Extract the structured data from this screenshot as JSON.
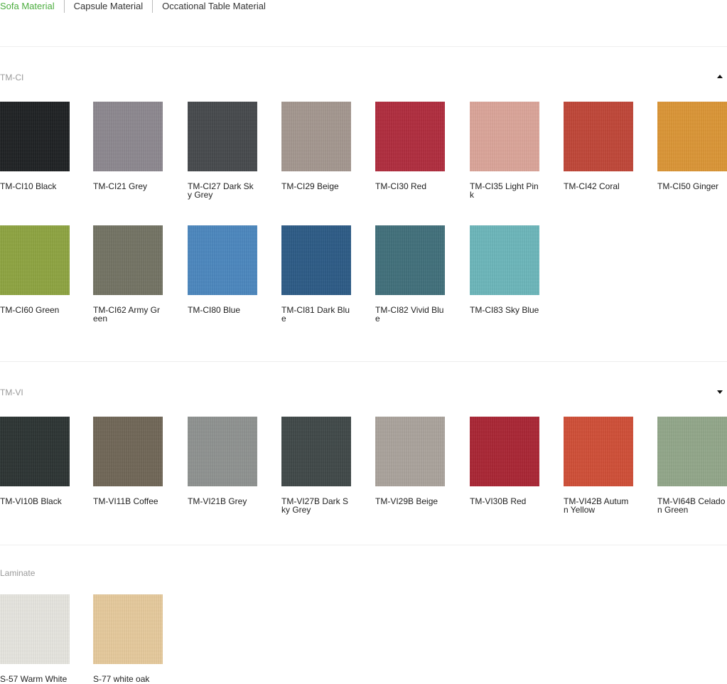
{
  "tabs": [
    {
      "label": "Sofa Material",
      "active": true
    },
    {
      "label": "Capsule Material",
      "active": false
    },
    {
      "label": "Occational Table Material",
      "active": false
    }
  ],
  "accent_color": "#4cad3f",
  "sections": [
    {
      "title": "TM-CI",
      "toggle": "collapse-up-icon",
      "swatches": [
        {
          "label": "TM-CI10 Black",
          "color": "#1c1f21"
        },
        {
          "label": "TM-CI21 Grey",
          "color": "#8d8890"
        },
        {
          "label": "TM-CI27 Dark Sky Grey",
          "color": "#45484b"
        },
        {
          "label": "TM-CI29 Beige",
          "color": "#a59890"
        },
        {
          "label": "TM-CI30 Red",
          "color": "#b22a3c"
        },
        {
          "label": "TM-CI35 Light Pink",
          "color": "#dea69a"
        },
        {
          "label": "TM-CI42 Coral",
          "color": "#c24536"
        },
        {
          "label": "TM-CI50 Ginger",
          "color": "#de9634"
        },
        {
          "label": "TM-CI60 Green",
          "color": "#8ea53f"
        },
        {
          "label": "TM-CI62 Army Green",
          "color": "#737363"
        },
        {
          "label": "TM-CI80 Blue",
          "color": "#4a87c0"
        },
        {
          "label": "TM-CI81 Dark Blue",
          "color": "#2a5a86"
        },
        {
          "label": "TM-CI82 Vivid Blue",
          "color": "#3f6f7b"
        },
        {
          "label": "TM-CI83 Sky Blue",
          "color": "#6bb8bc"
        }
      ]
    },
    {
      "title": "TM-VI",
      "toggle": "expand-down-icon",
      "swatches": [
        {
          "label": "TM-VI10B Black",
          "color": "#2a3231"
        },
        {
          "label": "TM-VI11B Coffee",
          "color": "#706656"
        },
        {
          "label": "TM-VI21B Grey",
          "color": "#8f9391"
        },
        {
          "label": "TM-VI27B Dark Sky Grey",
          "color": "#3e4747"
        },
        {
          "label": "TM-VI29B Beige",
          "color": "#aca49d"
        },
        {
          "label": "TM-VI30B Red",
          "color": "#ab2332"
        },
        {
          "label": "TM-VI42B Autumn Yellow",
          "color": "#d24d35"
        },
        {
          "label": "TM-VI64B Celadon Green",
          "color": "#93a88a"
        }
      ]
    },
    {
      "title": "Laminate",
      "swatches": [
        {
          "label": "S-57 Warm White",
          "color": "#e9e8e2"
        },
        {
          "label": "S-77 white oak",
          "color": "#e9cc9d"
        }
      ]
    }
  ]
}
